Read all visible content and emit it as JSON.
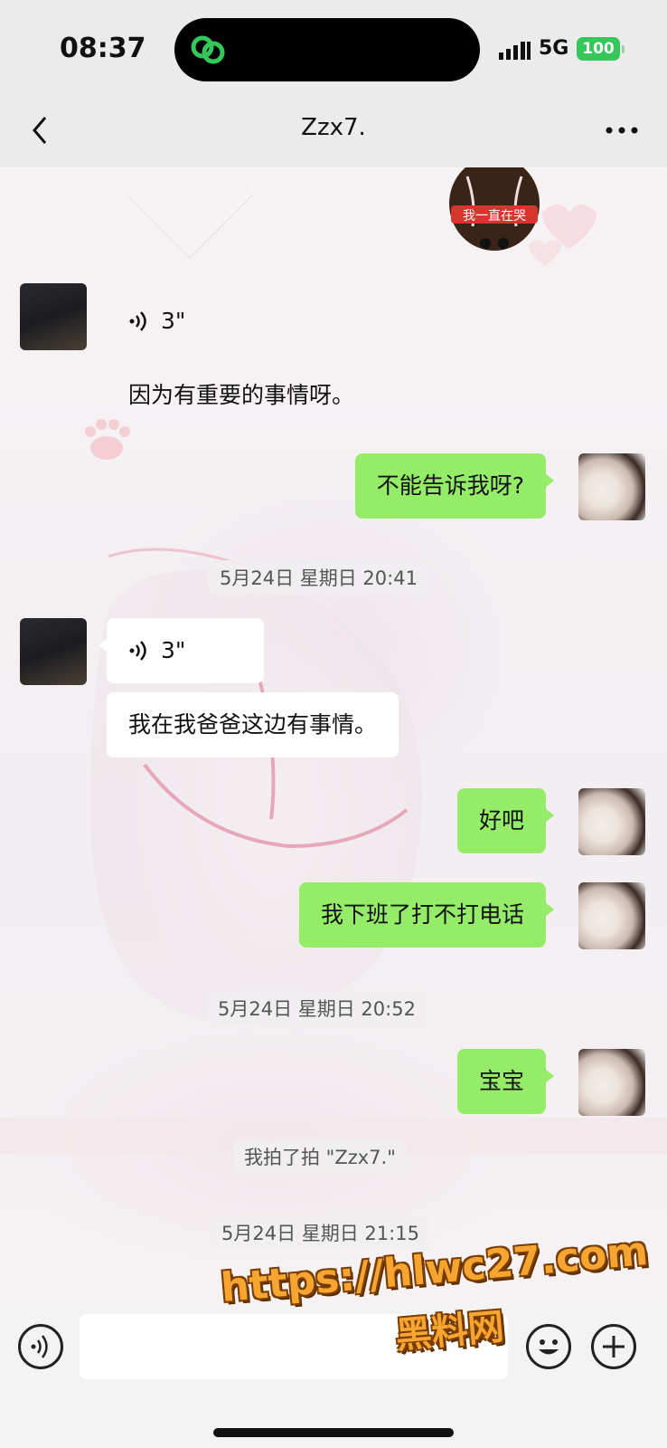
{
  "status_bar": {
    "time": "08:37",
    "network": "5G",
    "battery": "100",
    "battery_color": "#34c759",
    "island_icon": "link-chain-icon"
  },
  "header": {
    "title": "Zzx7.",
    "back_icon": "chevron-left-icon",
    "more_icon": "more-dots-icon"
  },
  "sticker": {
    "caption": "我一直在哭"
  },
  "messages": [
    {
      "side": "left",
      "type": "voice",
      "duration": "3\""
    },
    {
      "side": "left",
      "type": "text",
      "text": "因为有重要的事情呀。"
    },
    {
      "side": "right",
      "type": "text",
      "text": "不能告诉我呀?"
    },
    {
      "type": "timestamp",
      "text": "5月24日 星期日 20:41"
    },
    {
      "side": "left",
      "type": "voice",
      "duration": "3\""
    },
    {
      "side": "left",
      "type": "text",
      "text": "我在我爸爸这边有事情。"
    },
    {
      "side": "right",
      "type": "text",
      "text": "好吧"
    },
    {
      "side": "right",
      "type": "text",
      "text": "我下班了打不打电话"
    },
    {
      "type": "timestamp",
      "text": "5月24日 星期日 20:52"
    },
    {
      "side": "right",
      "type": "text",
      "text": "宝宝"
    },
    {
      "type": "system",
      "text": "我拍了拍 \"Zzx7.\""
    },
    {
      "type": "timestamp",
      "text": "5月24日 星期日 21:15"
    }
  ],
  "input_bar": {
    "voice_icon": "voice-mode-icon",
    "emoji_icon": "emoji-icon",
    "plus_icon": "plus-icon"
  },
  "watermark": {
    "line1": "https://hlwc27.com",
    "line2": "黑料网"
  },
  "colors": {
    "green_bubble": "#95ec69",
    "white_bubble": "#ffffff",
    "watermark_fill": "#f7a531"
  }
}
